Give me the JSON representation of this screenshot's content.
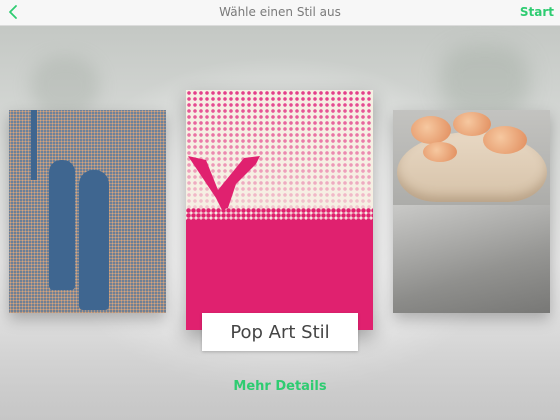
{
  "navbar": {
    "title": "Wähle einen Stil aus",
    "start_label": "Start",
    "back_icon": "chevron-left-icon"
  },
  "carousel": {
    "cards": [
      {
        "style": "left",
        "image": "blue-monotone-photo"
      },
      {
        "style": "center",
        "image": "pop-art-halftone-photo",
        "label": "Pop Art Stil"
      },
      {
        "style": "right",
        "image": "food-photo"
      }
    ]
  },
  "footer": {
    "details_label": "Mehr Details"
  },
  "colors": {
    "accent": "#2ecc71",
    "pop_pink": "#e0216f",
    "mono_blue": "#4b74a0"
  }
}
